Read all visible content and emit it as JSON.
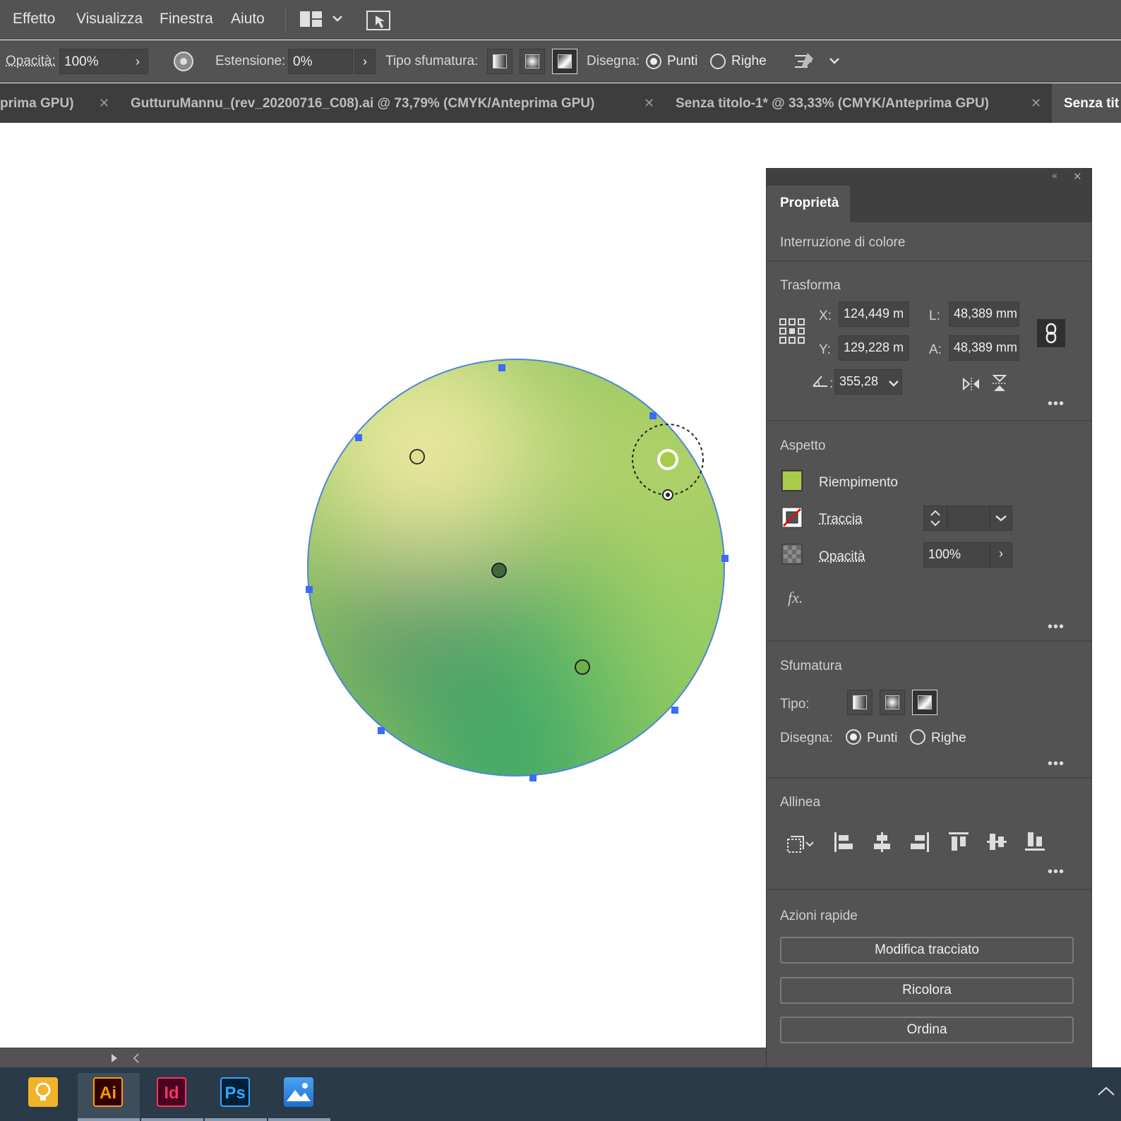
{
  "menubar": {
    "items": [
      "Effetto",
      "Visualizza",
      "Finestra",
      "Aiuto"
    ]
  },
  "controlbar": {
    "opacity_label": "Opacità:",
    "opacity_value": "100%",
    "extension_label": "Estensione:",
    "extension_value": "0%",
    "gradient_type_label": "Tipo sfumatura:",
    "draw_label": "Disegna:",
    "draw_options": [
      "Punti",
      "Righe"
    ],
    "draw_selected": "Punti"
  },
  "tabs": [
    {
      "label": "prima GPU)",
      "active": false
    },
    {
      "label": "GutturuMannu_(rev_20200716_C08).ai @ 73,79% (CMYK/Anteprima GPU)",
      "active": false
    },
    {
      "label": "Senza titolo-1* @ 33,33% (CMYK/Anteprima GPU)",
      "active": false
    },
    {
      "label": "Senza tit",
      "active": true
    }
  ],
  "panel": {
    "tab": "Proprietà",
    "context": "Interruzione di colore",
    "transform": {
      "title": "Trasforma",
      "x_label": "X:",
      "x_value": "124,449 m",
      "y_label": "Y:",
      "y_value": "129,228 m",
      "w_label": "L:",
      "w_value": "48,389 mm",
      "h_label": "A:",
      "h_value": "48,389 mm",
      "angle_value": "355,28"
    },
    "appearance": {
      "title": "Aspetto",
      "fill_label": "Riempimento",
      "stroke_label": "Traccia",
      "opacity_label": "Opacità",
      "opacity_value": "100%",
      "fill_color": "#a8cc4a",
      "fx_label": "fx."
    },
    "gradient": {
      "title": "Sfumatura",
      "type_label": "Tipo:",
      "draw_label": "Disegna:",
      "draw_options": [
        "Punti",
        "Righe"
      ]
    },
    "align": {
      "title": "Allinea"
    },
    "quick_actions": {
      "title": "Azioni rapide",
      "buttons": [
        "Modifica tracciato",
        "Ricolora",
        "Ordina"
      ]
    }
  },
  "taskbar": {
    "apps": [
      {
        "name": "Lightbulb",
        "label": ""
      },
      {
        "name": "Illustrator",
        "label": "Ai"
      },
      {
        "name": "InDesign",
        "label": "Id"
      },
      {
        "name": "Photoshop",
        "label": "Ps"
      },
      {
        "name": "Photos",
        "label": ""
      }
    ]
  }
}
